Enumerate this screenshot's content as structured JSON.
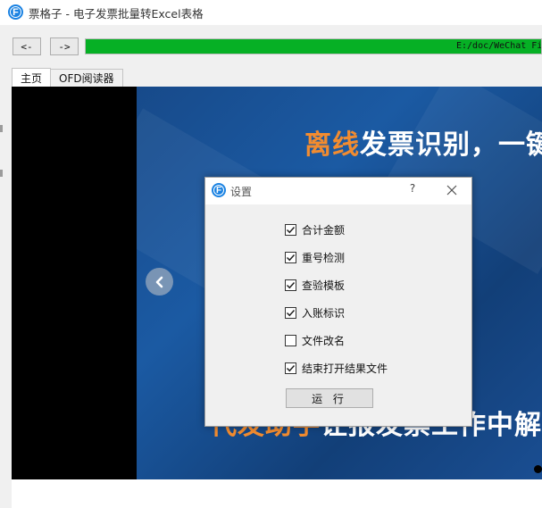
{
  "window": {
    "title": "票格子 - 电子发票批量转Excel表格",
    "icon": "app-logo-icon"
  },
  "toolbar": {
    "back_label": "<-",
    "forward_label": "->",
    "progress_percent": 100,
    "progress_text": "E:/doc/WeChat Fi",
    "progress_color": "#06b025"
  },
  "tabs": [
    {
      "label": "主页",
      "active": true
    },
    {
      "label": "OFD阅读器",
      "active": false
    }
  ],
  "banner": {
    "headline_accent": "离线",
    "headline_rest": "发票识别，一键",
    "subline_accent": "代发助手",
    "subline_rest": "让报发票工作中解",
    "accent_color": "#f28c30"
  },
  "dialog": {
    "title": "设置",
    "help_label": "?",
    "options": [
      {
        "label": "合计金额",
        "checked": true
      },
      {
        "label": "重号检测",
        "checked": true
      },
      {
        "label": "查验模板",
        "checked": true
      },
      {
        "label": "入账标识",
        "checked": true
      },
      {
        "label": "文件改名",
        "checked": false
      },
      {
        "label": "结束打开结果文件",
        "checked": true
      }
    ],
    "run_label": "运 行"
  }
}
